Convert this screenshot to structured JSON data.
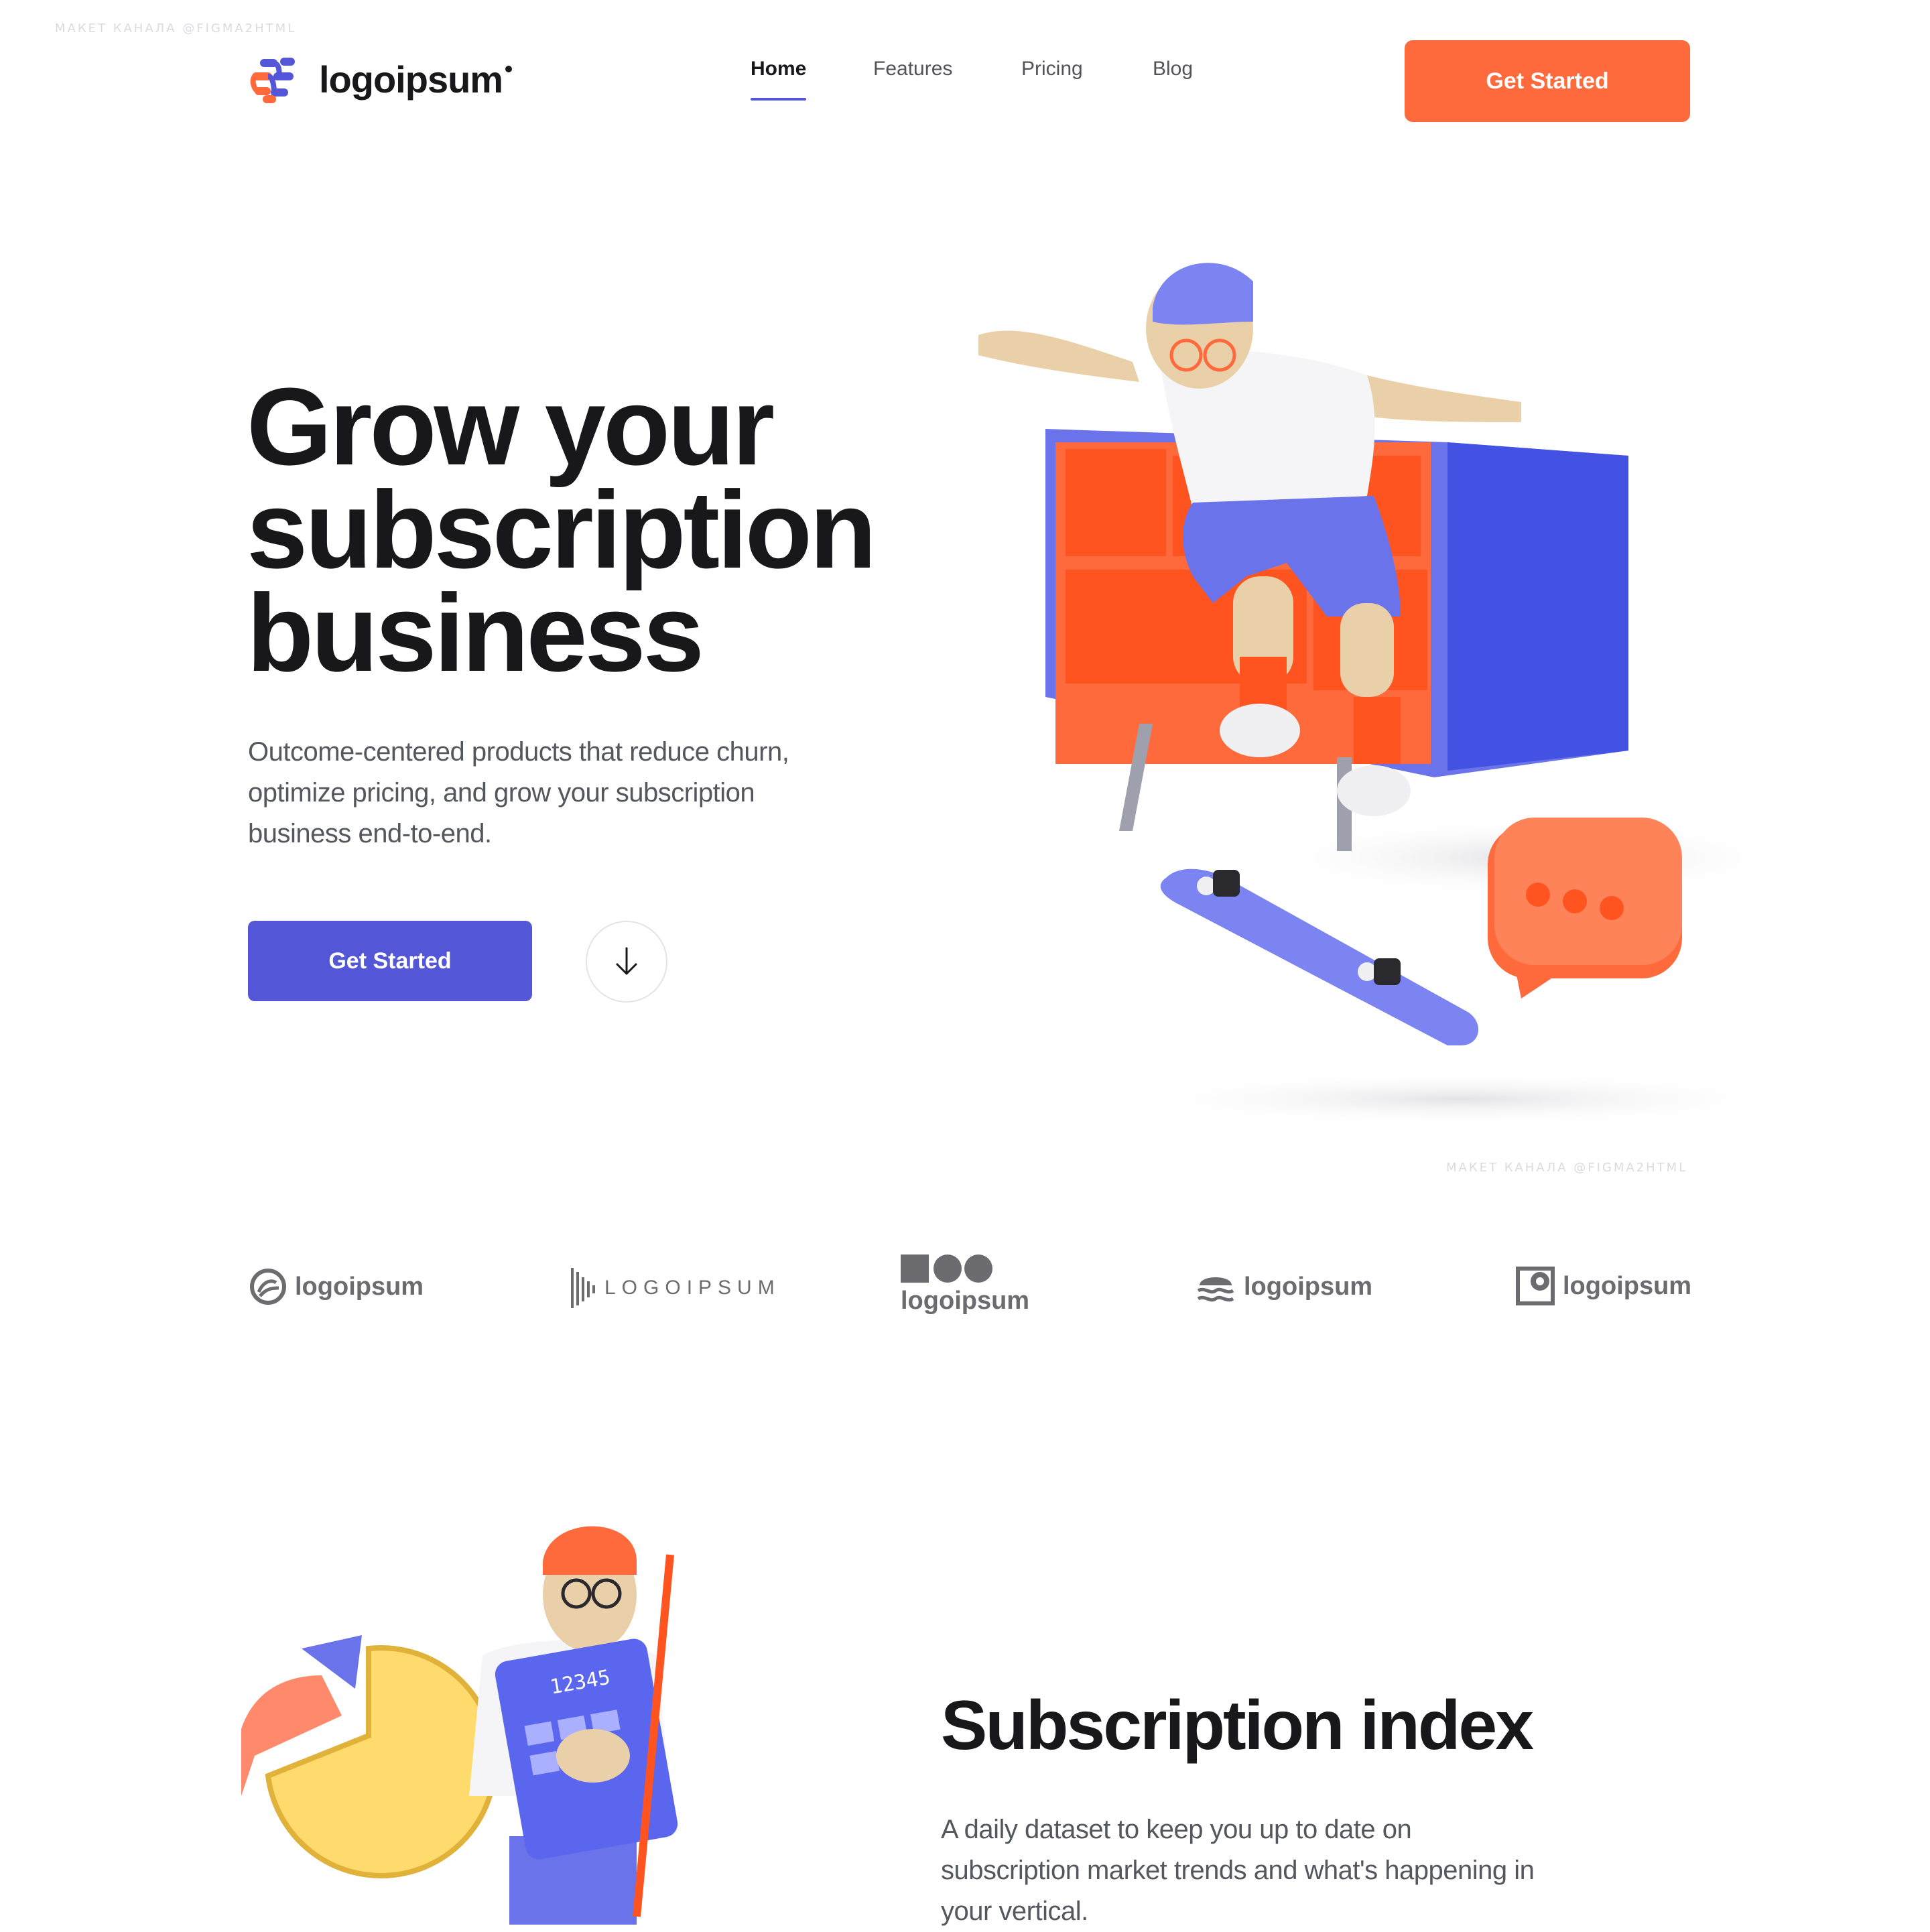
{
  "watermark": "МАКЕТ КАНАЛА @FIGMA2HTML",
  "brand": {
    "name": "logoipsum",
    "colors": {
      "accent_orange": "#ff6a3d",
      "accent_blue": "#5356d6",
      "text_dark": "#18181b"
    }
  },
  "nav": {
    "items": [
      {
        "label": "Home",
        "active": true
      },
      {
        "label": "Features",
        "active": false
      },
      {
        "label": "Pricing",
        "active": false
      },
      {
        "label": "Blog",
        "active": false
      }
    ],
    "cta_label": "Get Started"
  },
  "hero": {
    "title_lines": [
      "Grow your",
      "subscription",
      "business"
    ],
    "subtitle_lines": [
      "Outcome-centered products that reduce churn,",
      "optimize pricing, and grow your subscription",
      "business end-to-end."
    ],
    "cta_label": "Get Started",
    "scroll_icon": "arrow-down-icon",
    "illustration": "skateboarder-3d-illustration"
  },
  "partners": [
    {
      "text": "logoipsum",
      "icon": "circle-swirl-logo-icon"
    },
    {
      "text": "LOGOIPSUM",
      "icon": "barcode-logo-icon"
    },
    {
      "text": "logoipsum",
      "icon": "square-dots-logo-icon"
    },
    {
      "text": "logoipsum",
      "icon": "waves-logo-icon"
    },
    {
      "text": "logoipsum",
      "icon": "square-drop-logo-icon"
    }
  ],
  "section_index": {
    "title": "Subscription index",
    "text_lines": [
      "A daily dataset to keep you up to date on",
      "subscription market trends and what's happening in",
      "your vertical."
    ],
    "illustration": "man-with-calculator-and-pie-chart-3d-illustration",
    "calculator_display": "12345"
  }
}
